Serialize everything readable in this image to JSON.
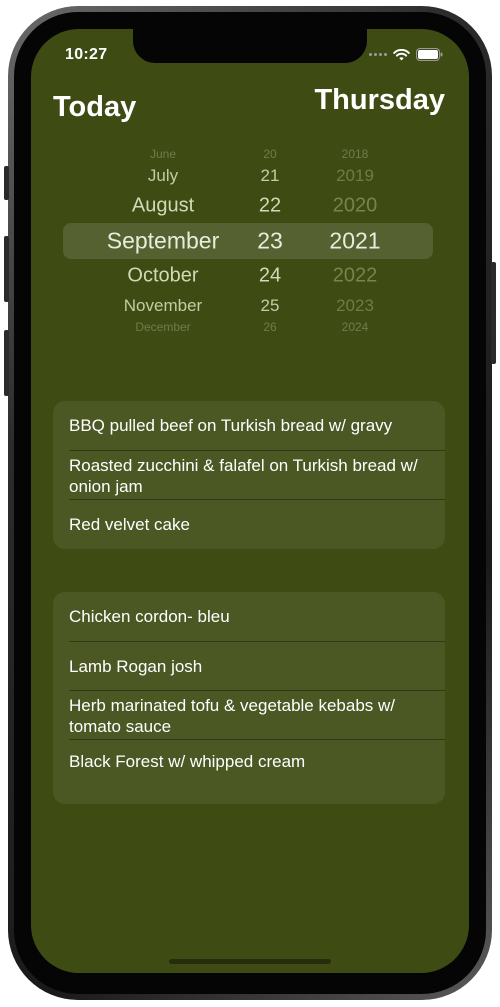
{
  "status_bar": {
    "time": "10:27"
  },
  "header": {
    "title": "Today",
    "day_name": "Thursday"
  },
  "date_picker": {
    "rows": [
      {
        "month": "June",
        "day": "20",
        "year": "2018"
      },
      {
        "month": "July",
        "day": "21",
        "year": "2019"
      },
      {
        "month": "August",
        "day": "22",
        "year": "2020"
      },
      {
        "month": "September",
        "day": "23",
        "year": "2021"
      },
      {
        "month": "October",
        "day": "24",
        "year": "2022"
      },
      {
        "month": "November",
        "day": "25",
        "year": "2023"
      },
      {
        "month": "December",
        "day": "26",
        "year": "2024"
      }
    ],
    "selected": {
      "month": "September",
      "day": "23",
      "year": "2021"
    }
  },
  "lunch_menu": {
    "items": [
      {
        "label": "BBQ pulled beef on Turkish bread w/ gravy"
      },
      {
        "label": "Roasted zucchini & falafel on Turkish bread w/ onion jam"
      },
      {
        "label": "Red velvet cake"
      }
    ]
  },
  "dinner_menu": {
    "items": [
      {
        "label": "Chicken cordon- bleu"
      },
      {
        "label": "Lamb Rogan josh"
      },
      {
        "label": "Herb marinated tofu & vegetable kebabs w/ tomato sauce"
      },
      {
        "label": "Black Forest w/ whipped cream"
      }
    ]
  }
}
